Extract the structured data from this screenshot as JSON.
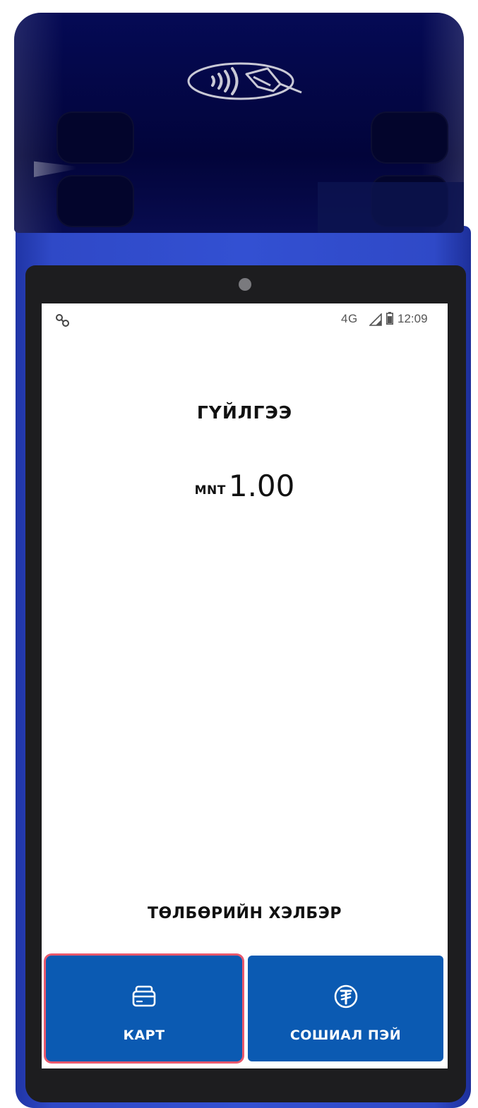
{
  "status_bar": {
    "network": "4G",
    "time": "12:09"
  },
  "transaction": {
    "title": "ГҮЙЛГЭЭ",
    "currency": "MNT",
    "amount": "1.00"
  },
  "payment": {
    "section_label": "ТӨЛБӨРИЙН ХЭЛБЭР",
    "methods": [
      {
        "label": "КАРТ",
        "icon": "card-icon",
        "selected": true
      },
      {
        "label": "СОШИАЛ ПЭЙ",
        "icon": "tugrik-coin-icon",
        "selected": false
      }
    ]
  },
  "colors": {
    "button_blue": "#0b5ab2",
    "selected_outline": "#e8586c",
    "device_body": "#3350d2",
    "device_top": "#02043a"
  }
}
